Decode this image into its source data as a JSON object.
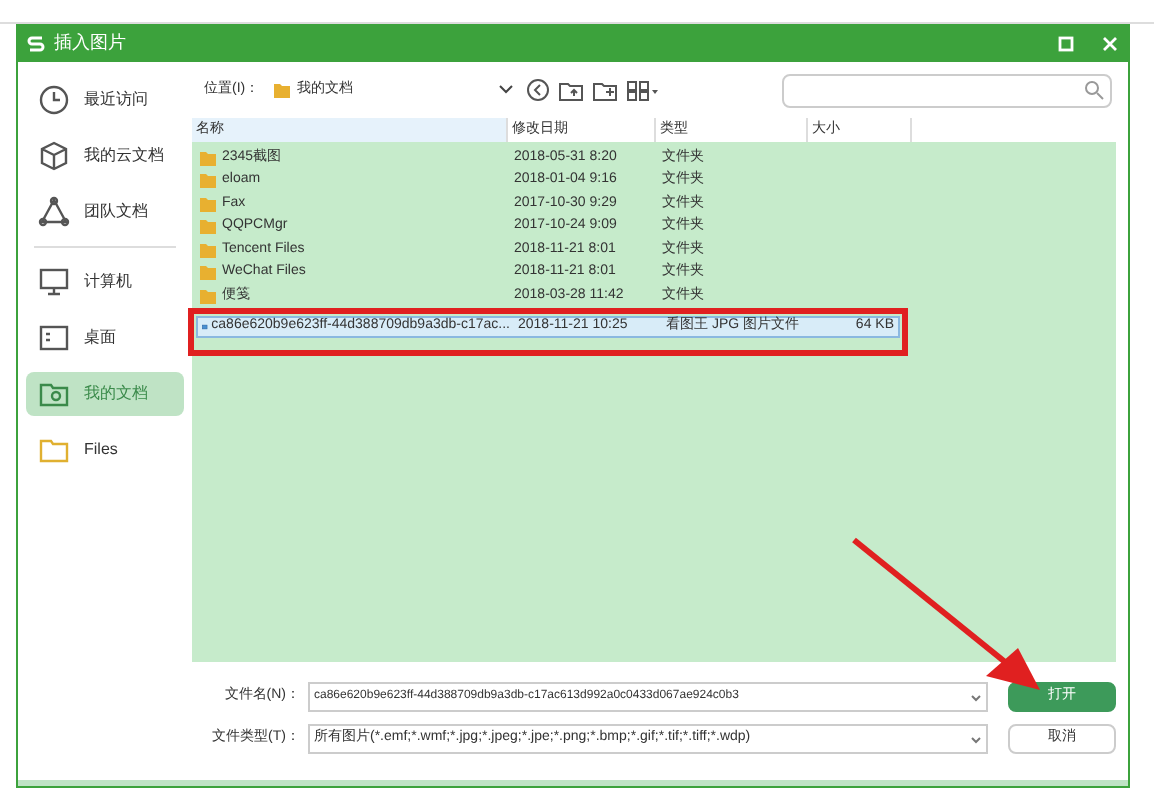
{
  "window": {
    "title": "插入图片"
  },
  "sidebar": {
    "items": [
      {
        "label": "最近访问",
        "kind": "clock",
        "selected": false
      },
      {
        "label": "我的云文档",
        "kind": "cube",
        "selected": false
      },
      {
        "label": "团队文档",
        "kind": "team",
        "selected": false
      },
      {
        "label": "计算机",
        "kind": "monitor",
        "selected": false
      },
      {
        "label": "桌面",
        "kind": "desktop",
        "selected": false
      },
      {
        "label": "我的文档",
        "kind": "docs",
        "selected": true
      },
      {
        "label": "Files",
        "kind": "folder",
        "selected": false
      }
    ]
  },
  "location": {
    "label": "位置(I)：",
    "value": "我的文档"
  },
  "table": {
    "columns": [
      "名称",
      "修改日期",
      "类型",
      "大小"
    ],
    "rows": [
      {
        "kind": "folder",
        "name": "2345截图",
        "date": "2018-05-31 8:20",
        "type": "文件夹",
        "selected": false
      },
      {
        "kind": "folder",
        "name": "eloam",
        "date": "2018-01-04 9:16",
        "type": "文件夹",
        "selected": false
      },
      {
        "kind": "folder",
        "name": "Fax",
        "date": "2017-10-30 9:29",
        "type": "文件夹",
        "selected": false
      },
      {
        "kind": "folder",
        "name": "QQPCMgr",
        "date": "2017-10-24 9:09",
        "type": "文件夹",
        "selected": false
      },
      {
        "kind": "folder",
        "name": "Tencent Files",
        "date": "2018-11-21 8:01",
        "type": "文件夹",
        "selected": false
      },
      {
        "kind": "folder",
        "name": "WeChat Files",
        "date": "2018-11-21 8:01",
        "type": "文件夹",
        "selected": false
      },
      {
        "kind": "folder",
        "name": "便笺",
        "date": "2018-03-28 11:42",
        "type": "文件夹",
        "selected": false
      },
      {
        "kind": "file",
        "name": "ca86e620b9e623ff-44d388709db9a3db-c17ac...",
        "date": "2018-11-21 10:25",
        "type": "看图王 JPG 图片文件",
        "size": "64 KB",
        "selected": true
      }
    ]
  },
  "filename": {
    "label": "文件名(N)：",
    "value": "ca86e620b9e623ff-44d388709db9a3db-c17ac613d992a0c0433d067ae924c0b3"
  },
  "filetype": {
    "label": "文件类型(T)：",
    "value": "所有图片(*.emf;*.wmf;*.jpg;*.jpeg;*.jpe;*.png;*.bmp;*.gif;*.tif;*.tiff;*.wdp)"
  },
  "buttons": [
    {
      "label": "打开",
      "kind": "primary"
    },
    {
      "label": "取消",
      "kind": "secondary"
    }
  ]
}
